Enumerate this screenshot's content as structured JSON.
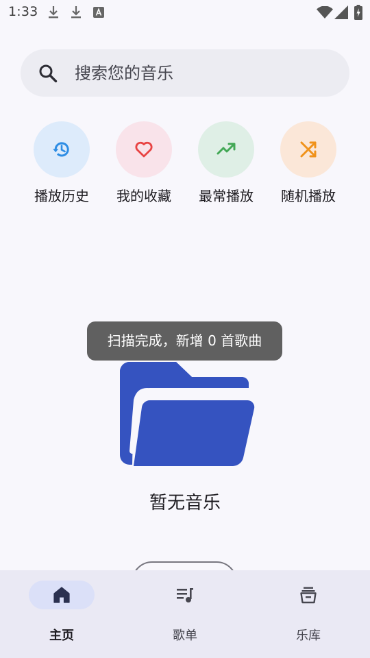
{
  "status_bar": {
    "time": "1:33",
    "icons": [
      "download-icon",
      "download-icon",
      "keyboard-a-icon",
      "wifi-icon",
      "signal-icon",
      "battery-charging-icon"
    ]
  },
  "search": {
    "placeholder": "搜索您的音乐"
  },
  "quick_actions": [
    {
      "label": "播放历史",
      "icon": "history-icon",
      "bg": "#ddebfb",
      "color": "#2e8de4"
    },
    {
      "label": "我的收藏",
      "icon": "heart-icon",
      "bg": "#f9e3ea",
      "color": "#e84343"
    },
    {
      "label": "最常播放",
      "icon": "trending-up-icon",
      "bg": "#dfefe6",
      "color": "#43a856"
    },
    {
      "label": "随机播放",
      "icon": "shuffle-icon",
      "bg": "#fbe7d8",
      "color": "#f0921a"
    }
  ],
  "toast": {
    "text": "扫描完成，新增 0 首歌曲"
  },
  "empty_state": {
    "icon": "folder-open-icon",
    "text": "暂无音乐",
    "icon_color": "#3553c0"
  },
  "bottom_nav": {
    "items": [
      {
        "label": "主页",
        "icon": "home-icon",
        "active": true
      },
      {
        "label": "歌单",
        "icon": "playlist-icon",
        "active": false
      },
      {
        "label": "乐库",
        "icon": "library-icon",
        "active": false
      }
    ]
  }
}
